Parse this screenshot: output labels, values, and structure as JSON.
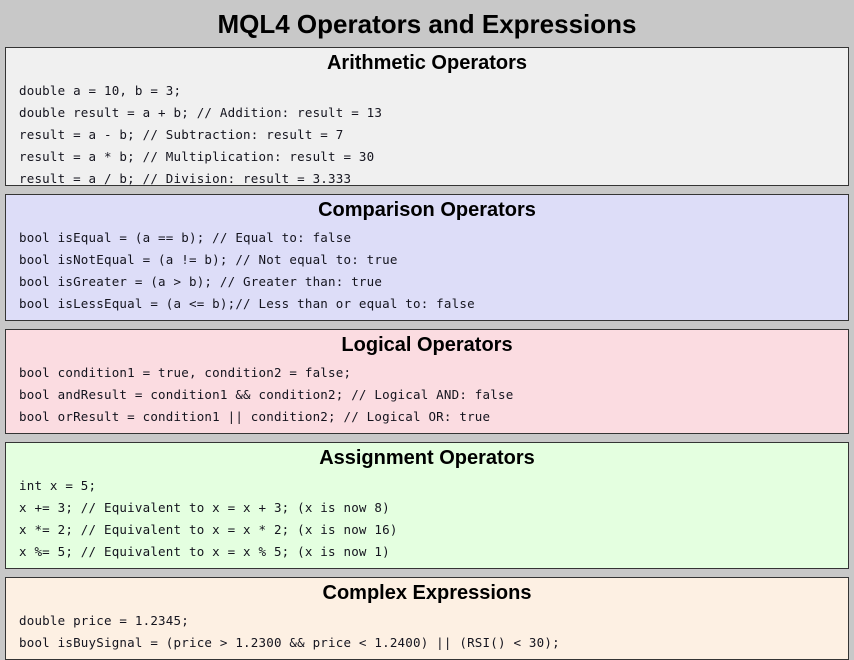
{
  "page": {
    "title": "MQL4 Operators and Expressions",
    "background_color": "#c8c8c8",
    "border_color": "#343434"
  },
  "sections": [
    {
      "id": "arithmetic",
      "title": "Arithmetic Operators",
      "background_color": "#f0f0f0",
      "clipped": true,
      "lines": [
        "double a = 10, b = 3;",
        "double result = a + b; // Addition: result = 13",
        "result = a - b; // Subtraction: result = 7",
        "result = a * b; // Multiplication: result = 30",
        "result = a / b; // Division: result = 3.333"
      ]
    },
    {
      "id": "comparison",
      "title": "Comparison Operators",
      "background_color": "#ddddf8",
      "clipped": false,
      "lines": [
        "bool isEqual = (a == b); // Equal to: false",
        "bool isNotEqual = (a != b); // Not equal to: true",
        "bool isGreater = (a > b); // Greater than: true",
        "bool isLessEqual = (a <= b);// Less than or equal to: false"
      ]
    },
    {
      "id": "logical",
      "title": "Logical Operators",
      "background_color": "#fbdce1",
      "clipped": false,
      "lines": [
        "bool condition1 = true, condition2 = false;",
        "bool andResult = condition1 && condition2; // Logical AND: false",
        "bool orResult = condition1 || condition2; // Logical OR: true"
      ]
    },
    {
      "id": "assignment",
      "title": "Assignment Operators",
      "background_color": "#e4ffe0",
      "clipped": false,
      "lines": [
        "int x = 5;",
        "x += 3; // Equivalent to x = x + 3; (x is now 8)",
        "x *= 2; // Equivalent to x = x * 2; (x is now 16)",
        "x %= 5; // Equivalent to x = x % 5; (x is now 1)"
      ]
    },
    {
      "id": "complex",
      "title": "Complex Expressions",
      "background_color": "#fdf0e3",
      "clipped": false,
      "lines": [
        "double price = 1.2345;",
        "bool isBuySignal = (price > 1.2300 && price < 1.2400) || (RSI() < 30);"
      ]
    }
  ]
}
